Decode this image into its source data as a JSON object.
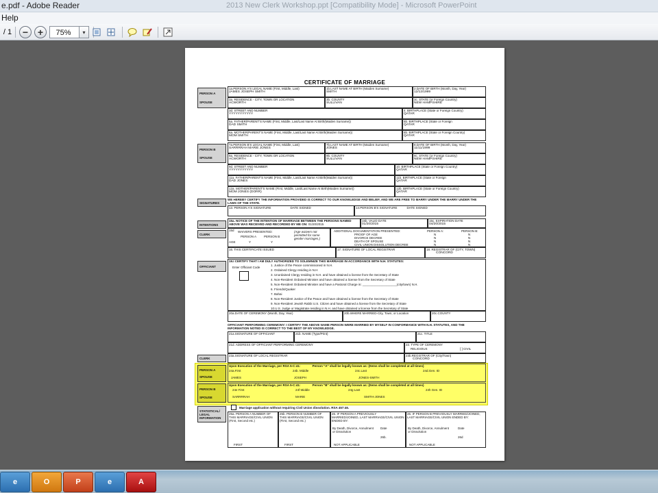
{
  "window": {
    "title": "e.pdf - Adobe Reader",
    "center_title": "2013 New Clerk Workshop.ppt [Compatibility Mode] - Microsoft PowerPoint"
  },
  "menu": {
    "help": "Help"
  },
  "toolbar": {
    "page_count": "/ 1",
    "zoom": "75%",
    "zoom_out": "−",
    "zoom_in": "+",
    "dropdown": "▾"
  },
  "icons": {
    "zoom_out": "minus-circle-icon",
    "zoom_in": "plus-circle-icon",
    "fit_page": "fit-page-icon",
    "fit_width": "fit-width-icon",
    "comment": "comment-icon",
    "sign": "sign-icon",
    "expand": "expand-icon"
  },
  "document": {
    "title": "CERTIFICATE OF MARRIAGE",
    "sections": {
      "person_a": "PERSON A",
      "spouse": "SPOUSE",
      "person_b": "PERSON B",
      "signatures": "SIGNATURES",
      "intentions": "INTENTIONS",
      "clerk": "CLERK",
      "officiant": "OFFICIANT",
      "clerk2": "CLERK",
      "person_a2": "PERSON A",
      "spouse2": "SPOUSE",
      "person_b2": "PERSON B",
      "spouse3": "SPOUSE",
      "statistical": "STATISTICAL/ LEGAL INFORMATION"
    },
    "a": {
      "l1a": "1a.PERSON A'S LEGAL NAME (First, Middle, Last)",
      "v1a": "JAMES JOSEPH SMITH",
      "l1b": "1b.LAST NAME AT BIRTH (Maiden Surname)",
      "v1b": "SMITH",
      "l2": "2.DATE OF BIRTH (Month, Day, Year)",
      "v2": "12/12/1999",
      "l3a": "3a. RESIDENCE - CITY, TOWN OR LOCATION",
      "v3a": "ACWORTH",
      "l3b": "3b. COUNTY",
      "v3b": "SULLIVAN",
      "l3c": "3c. STATE (or Foreign Country)",
      "v3c": "NEW HAMPSHIRE",
      "l3d": "3d. STREET AND NUMBER",
      "v3d": "YYYYYYYYYYY",
      "l4": "4. BIRTHPLACE (State or Foreign Country)",
      "v4": "QATAR",
      "l5a": "5a. FATHER/PARENT'S NAME (First, Middle, Last/Last Name At Birth(Maiden Surname))",
      "v5a": "DAD SMITH",
      "l5b": "5b. BIRTHPLACE (State or Foreign",
      "v5b": "QATAR",
      "l6a": "6a. MOTHER/PARENT'S NAME (First, Middle, Last/Last Name At Birth(Maiden Surname))",
      "v6a": "MOM SMITH",
      "l6b": "6b. BIRTHPLACE (State or Foreign Country)",
      "v6b": "QATAR"
    },
    "b": {
      "l7a": "7a.PERSON B'S LEGAL NAME (First, Middle, Last)",
      "v7a": "SARRRRAH MARIE JONES",
      "l7b": "7b.LAST NAME AT BIRTH (Maiden Surname)",
      "v7b": "JONES",
      "l8": "8.DATE OF BIRTH (Month, Day, Year)",
      "v8": "11/11/1999",
      "l9a": "9a. RESIDENCE - CITY, TOWN OR LOCATION",
      "v9a": "ACWORTH",
      "l9b": "9b. COUNTY",
      "v9b": "SULLIVAN",
      "l9c": "9c. STATE (or Foreign Country)",
      "v9c": "NEW HAMPSHIRE",
      "l9d": "9d. STREET AND NUMBER",
      "v9d": "YYYYYYYYYYY",
      "l10": "10. BIRTHPLACE (State or Foreign Country)",
      "v10": "QATAR",
      "l11a": "11a. FATHER/PARENT'S NAME (First, Middle, Last/Last Name At Birth(Maiden Surname))",
      "v11a": "DAD JONES",
      "l11b": "11b. BIRTHPLACE (State or Foreign",
      "v11b": "QATAR",
      "l12a": "12a. MOTHER/PARENT'S NAME (First, Middle, Last/Last Name At Birth(Maiden Surname))",
      "v12a": "MOM JONES (DORR)",
      "l12b": "12b. BIRTHPLACE (State or Foreign Country)",
      "v12b": "QATAR"
    },
    "sig": {
      "certify": "WE HEREBY CERTIFY THE INFORMATION PROVIDED IS CORRECT TO OUR KNOWLEDGE AND BELIEF, AND WE ARE FREE TO MARRY UNDER THE MARRY UNDER THE LAWS OF THE STATE.",
      "l13": "13. PERSON A'S SIGNATURE",
      "l13d": "DATE SIGNED",
      "l14": "14.PERSON B'S SIGNATURE",
      "l14d": "DATE SIGNED"
    },
    "int": {
      "l15a": "15a. NOTICE OF THE INTENTION OF MARRIAGE BETWEEN THE PERSONS NAMED ABOVE WAS RECEIVED AND RECORDED BY ME ON:",
      "v15a": "01/20/2015",
      "l15b": "15b. VALID DATE",
      "v15b": "01/20/2015",
      "l15c": "15c. EXPIRATION DATE",
      "v15c": "04/20/2015"
    },
    "clerk": {
      "l15d": "15d",
      "waivers": "WAIVERS PRESENTED:",
      "pa": "PERSON A",
      "pb": "PERSON B",
      "age": "AGE",
      "ya": "Y",
      "yb": "Y",
      "note": "(Age waivers not permitted for same gender marriages.)",
      "additional": "ADDITIONAL DOCUMENTATION PRESENTED:",
      "proof": "PROOF OF AGE",
      "divorce": "DIVORCE DECREE",
      "death": "DEATH OF SPOUSE",
      "cud": "CIVIL UNION DISSOLUTION DECREE",
      "pa2": "PERSON A:",
      "pb2": "PERSON B:",
      "n": "N",
      "l16": "16. THIS CERTIFICATE ISSUED",
      "l17": "17. SIGNATURE OF LOCAL REGISTRAR",
      "l18": "18. REGISTRAR OF (CITY, TOWN)",
      "v18": "CONCORD"
    },
    "off": {
      "l19": "19.I CERTIFY THAT I AM DULY AUTHORIZED TO SOLEMNIZE THIS MARRIAGE IN ACCORDANCE WITH N.H. STATUTES:",
      "code": "Enter Officiant Code",
      "items": [
        "1. Justice of the Peace commissioned in N.H.",
        "2. Ordained Clergy residing in N.H",
        "3. Unordained Clergy residing in N.H. and have obtained a license from the Secretary of State",
        "4. Non-Resident Ordained Minister and have obtained a license from the Secretary of State",
        "5. Non-Resident Ordained Minister and have a Pastoral Charge in: ____________________(city/town) N.H.",
        "6. Friends/Quaker",
        "7. Bahai",
        "8. Non-Resident Justice of the Peace and have obtained a license from the Secretary of State",
        "9. Non-Resident Jewish Rabbi U.S. Citizen and have obtained a license from the Secretary of State",
        "10.U.S. Judge or Magistrate residing in N.H. and have obtained a license from the Secretary of State"
      ],
      "l20a": "20a.DATE OF CEREMONY (Month, Day, Year)",
      "l20b": "20b.WHERE MARRIED-City, Town, or Location",
      "l20c": "20c.COUNTY",
      "perform": "OFFICIANT PERFORMING CEREMONY: I CERTIFY THE ABOVE NAME PERSON WERE MARRIED BY MYSELF IN CONFORMANCE WITH N.H. STATUTES, AND THE INFORMATION NOTED IS CORRECT TO THE BEST OF MY KNOWLEDGE.",
      "l21a": "21a.SIGNATURE OF OFFICIANT",
      "l21b": "21b. NAME (Type/Print)",
      "l21c": "21c. TITLE",
      "l21d": "21d. ADDRESS OF OFFICIANT PERFORMING CEREMONY",
      "l22": "22. TYPE OF CEREMONY",
      "relig": "RELIGIOUS",
      "civil": "[ ] CIVIL",
      "l23a": "23a.SIGNATURE OF LOCAL REGISTRAR",
      "l23b": "23b.REGISTRAR OF (City/Town)",
      "v23b": "CONCORD"
    },
    "exec": {
      "a_head": "Upon Execution of the Marriage, per RSA 5-C:41:",
      "a_known": "Person \"A\" shall be legally known as: (Items shall be completed at all times)",
      "l24a": "24a.First",
      "l24b": "24b. Middle",
      "l24c": "24c.Last",
      "l24d": "24d.Gen. ID",
      "v24a": "JAMES",
      "v24b": "JOSEPH",
      "v24c": "JONES-SMITH",
      "b_head": "Upon Execution of the Marriage, per RSA 5-C:41:",
      "b_known": "Person \"B\" shall be legally known as: (Items shall be completed at all times)",
      "l24e": "24e First",
      "l24f": "24f Middle",
      "l24g": "24g Last",
      "l24h": "24h Gen. ID",
      "v24e": "SARRRRAH",
      "v24f": "MARIE",
      "v24g": "SMITH-JONES"
    },
    "stat": {
      "civil_union": "Marriage application without requiring Civil Union dissolution. RSA 457:46.",
      "l25a": "25a. PERSON A NUMBER OF THIS MARRIAGE/CIVIL UNION (First, Second etc.)",
      "l25b": "25b. PERSON B NUMBER OF THIS MARRIAGE/CIVIL UNION (First, Second etc.)",
      "l26": "26. IF PERSON A PREVIOUSLY MARRIED/JOINED, LAST MARRIAGE/CIVIL UNION ENDED BY:",
      "l26b": "26. IF PERSON B PREVIOUSLY MARRIED/JOINED, LAST MARRIAGE/CIVIL UNION ENDED BY:",
      "bydeath": "By Death, Divorce, Annulment or Dissolution",
      "date": "Date",
      "l26b_lbl": "26b.",
      "l26d_lbl": "26d",
      "va": "FIRST",
      "vb": "FIRST",
      "na1": "NOT APPLICABLE",
      "na2": "NOT APPLICABLE"
    }
  },
  "taskbar": {
    "ie": "e",
    "outlook": "O",
    "powerpoint": "P",
    "ie2": "e",
    "acrobat": "A"
  }
}
